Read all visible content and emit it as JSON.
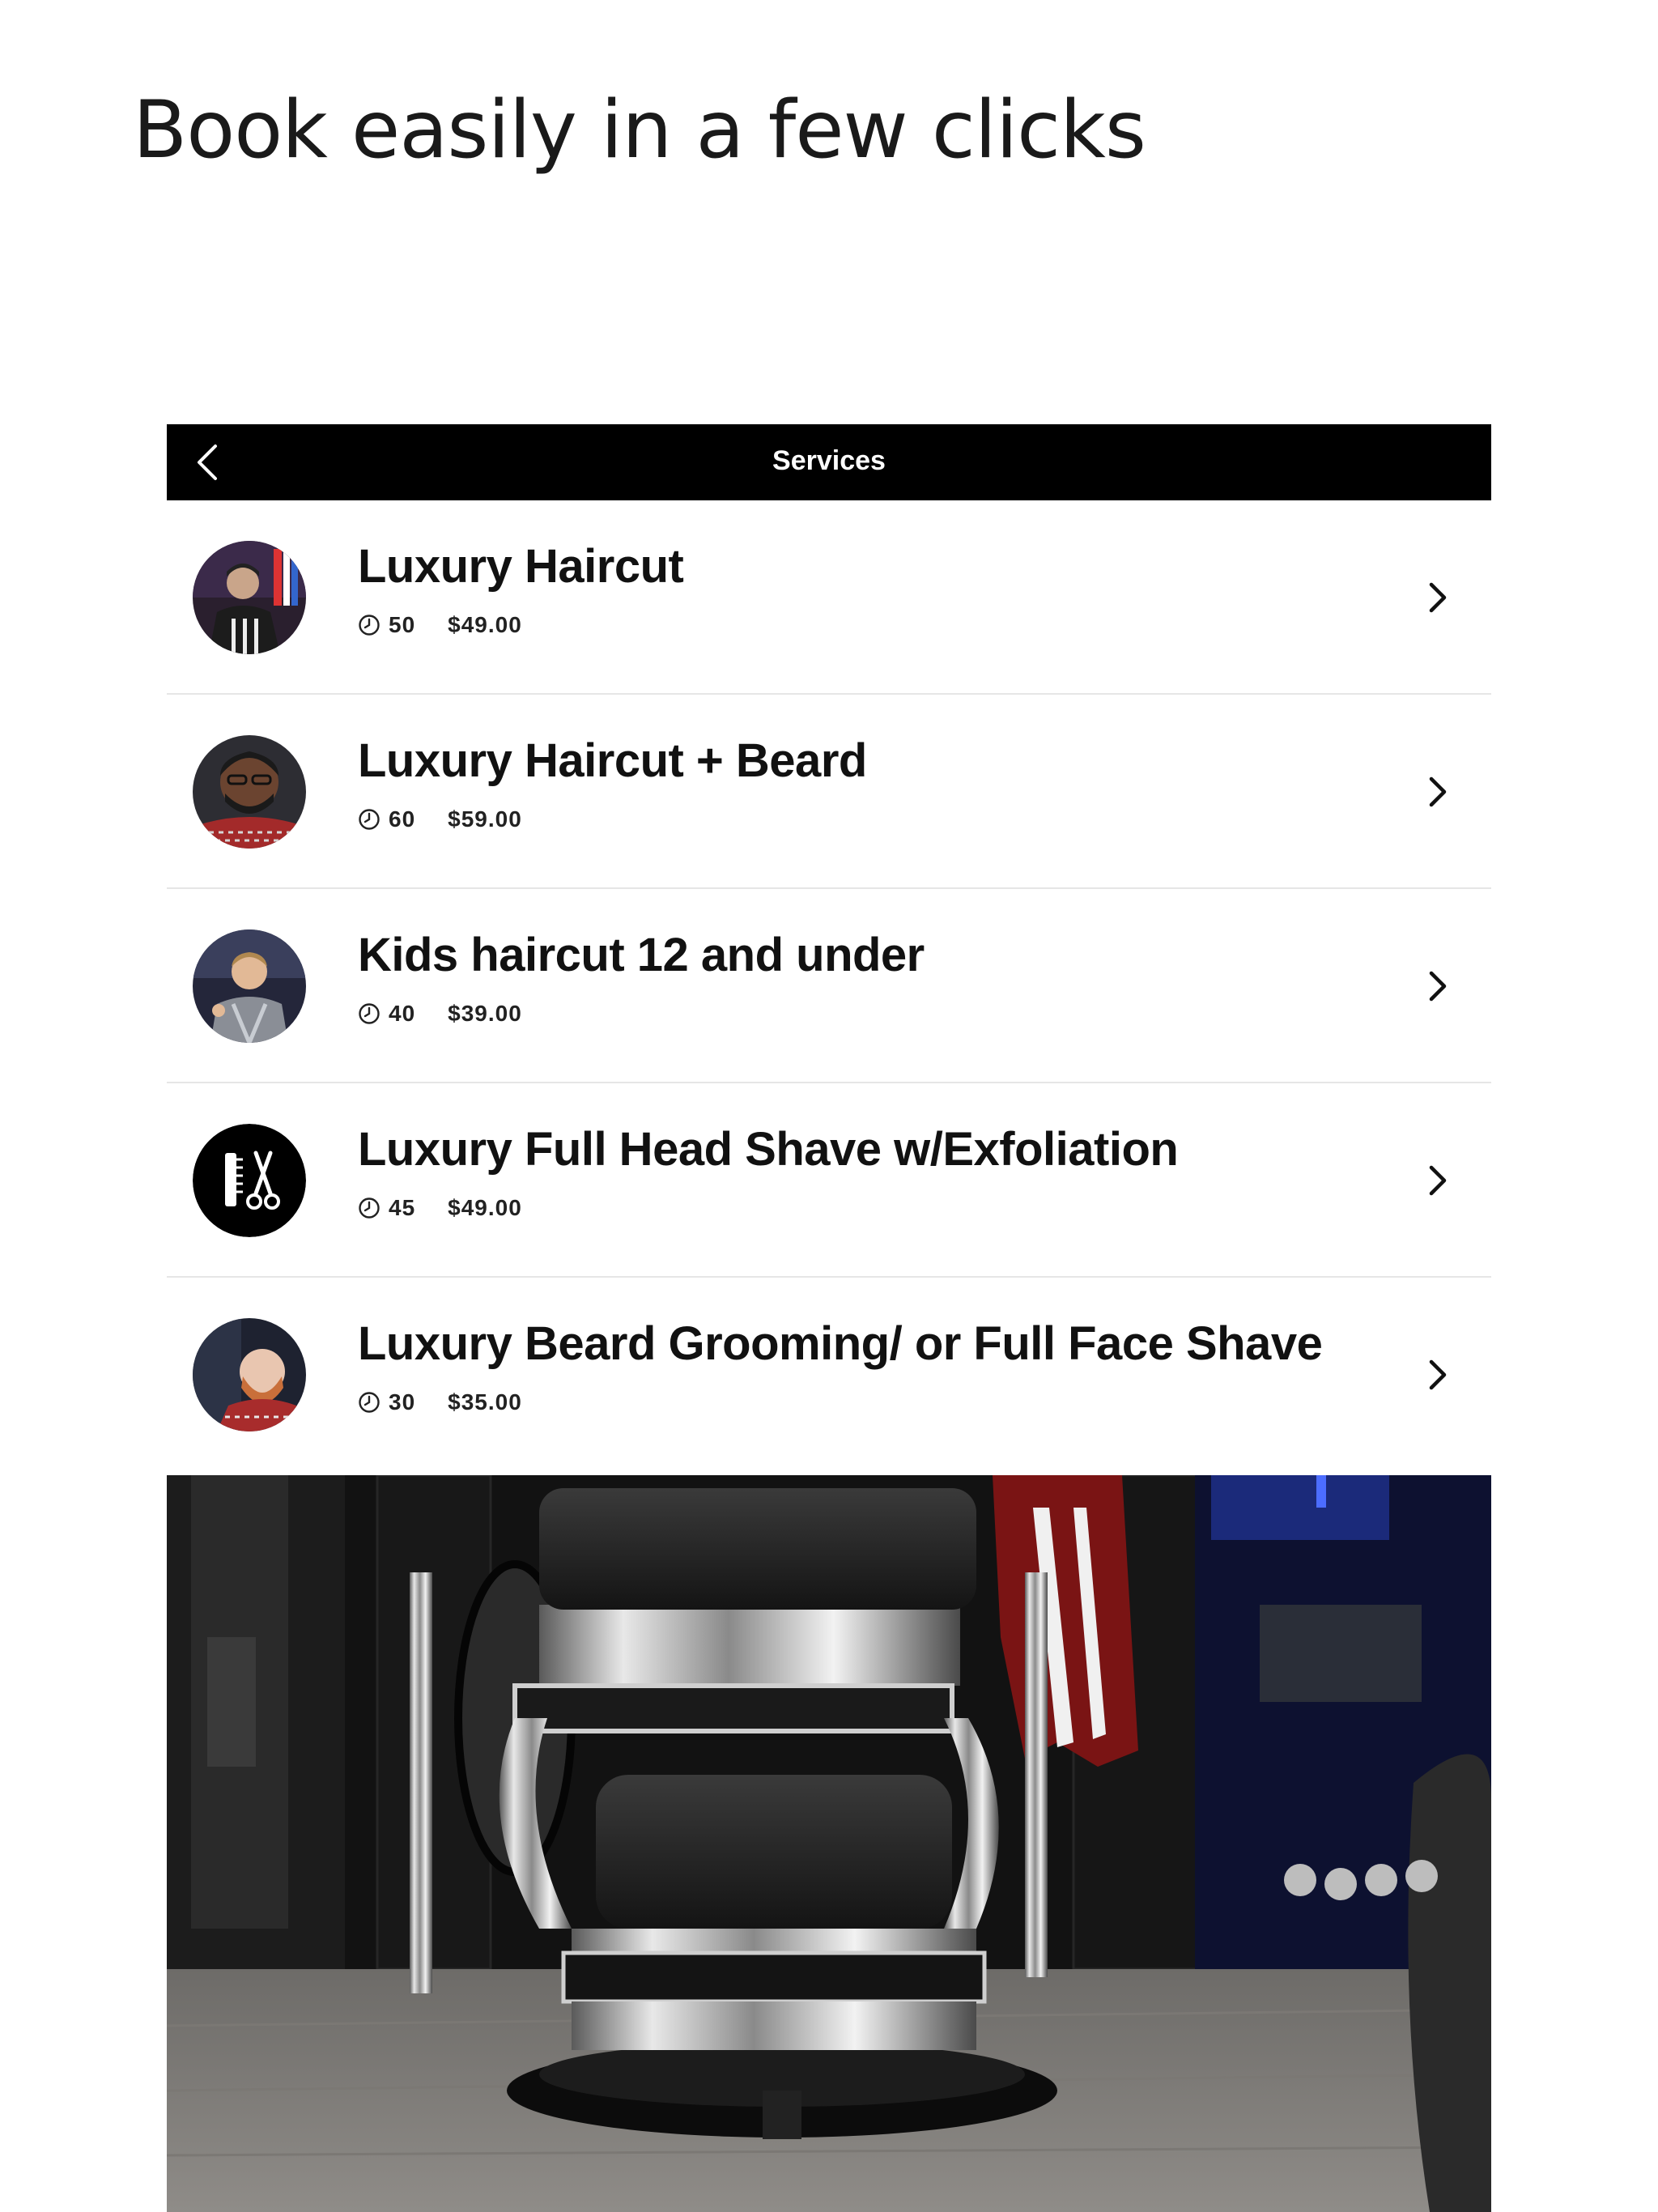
{
  "headline": "Book easily in a few clicks",
  "nav": {
    "title": "Services",
    "back_icon": "chevron-left-icon"
  },
  "services": [
    {
      "title": "Luxury Haircut",
      "duration": "50",
      "price": "$49.00",
      "avatar": "barber-photo"
    },
    {
      "title": "Luxury Haircut + Beard",
      "duration": "60",
      "price": "$59.00",
      "avatar": "barber-photo"
    },
    {
      "title": "Kids haircut 12 and under",
      "duration": "40",
      "price": "$39.00",
      "avatar": "kid-photo"
    },
    {
      "title": "Luxury Full Head Shave w/Exfoliation",
      "duration": "45",
      "price": "$49.00",
      "avatar": "comb-scissors-logo"
    },
    {
      "title": "Luxury Beard Grooming/ or Full Face Shave",
      "duration": "30",
      "price": "$35.00",
      "avatar": "beard-photo"
    }
  ],
  "icons": {
    "duration": "clock-icon",
    "row_action": "chevron-right-icon"
  },
  "colors": {
    "nav_background": "#000000",
    "nav_text": "#ffffff",
    "divider": "#e6e6e6"
  }
}
